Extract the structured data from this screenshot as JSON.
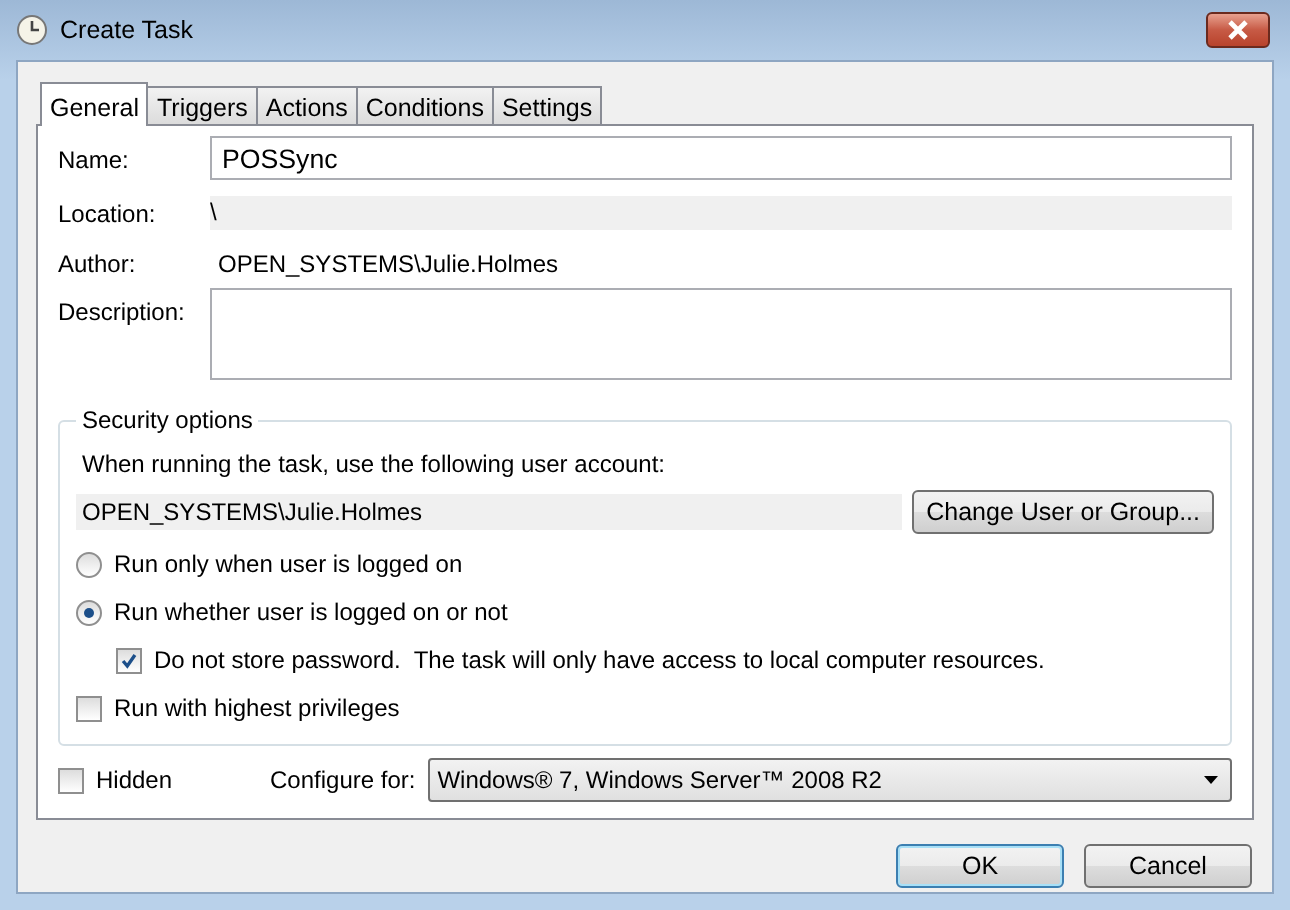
{
  "window": {
    "title": "Create Task"
  },
  "tabs": [
    {
      "label": "General",
      "selected": true
    },
    {
      "label": "Triggers",
      "selected": false
    },
    {
      "label": "Actions",
      "selected": false
    },
    {
      "label": "Conditions",
      "selected": false
    },
    {
      "label": "Settings",
      "selected": false
    }
  ],
  "fields": [
    {
      "kind": "input",
      "label": "Name:",
      "value": "POSSync"
    },
    {
      "kind": "readonly",
      "label": "Location:",
      "value": "\\"
    },
    {
      "kind": "text",
      "label": "Author:",
      "value": "OPEN_SYSTEMS\\Julie.Holmes"
    },
    {
      "kind": "textarea",
      "label": "Description:"
    }
  ],
  "security": {
    "title": "Security options",
    "account_prompt": "When running the task, use the following user account:",
    "account": "OPEN_SYSTEMS\\Julie.Holmes",
    "change_button": "Change User or Group...",
    "options": [
      {
        "kind": "radio",
        "label": "Run only when user is logged on",
        "selected": false
      },
      {
        "kind": "radio",
        "label": "Run whether user is logged on or not",
        "selected": true
      },
      {
        "kind": "subcheck",
        "label": "Do not store password.  The task will only have access to local computer resources.",
        "checked": true
      },
      {
        "kind": "check",
        "label": "Run with highest privileges",
        "checked": false
      }
    ]
  },
  "hidden": {
    "label": "Hidden",
    "checked": false
  },
  "configure": {
    "label": "Configure for:",
    "value": "Windows® 7, Windows Server™ 2008 R2"
  },
  "buttons": [
    {
      "label": "OK",
      "default": true
    },
    {
      "label": "Cancel",
      "default": false
    }
  ]
}
